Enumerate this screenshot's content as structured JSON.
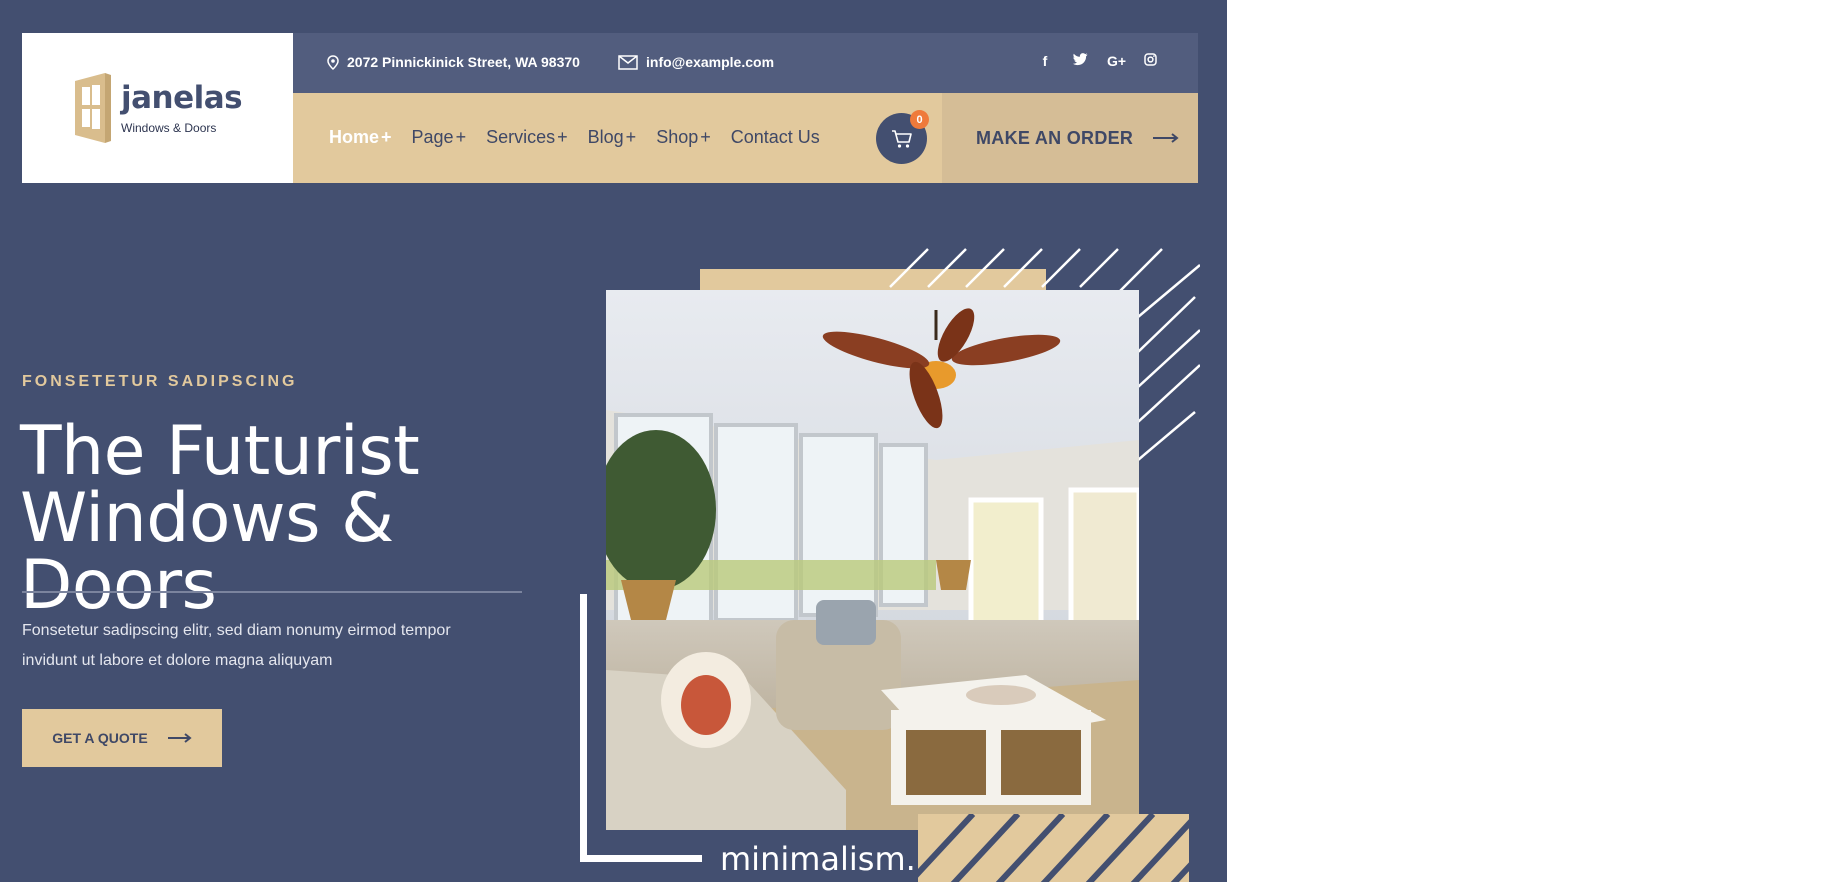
{
  "brand": {
    "name": "janelas",
    "tagline": "Windows & Doors"
  },
  "topbar": {
    "address": "2072 Pinnickinick Street, WA 98370",
    "email": "info@example.com",
    "social": [
      {
        "icon": "facebook-icon",
        "glyph": "f"
      },
      {
        "icon": "twitter-icon",
        "glyph": "t"
      },
      {
        "icon": "google-plus-icon",
        "glyph": "G+"
      },
      {
        "icon": "instagram-icon",
        "glyph": "ig"
      }
    ]
  },
  "nav": {
    "items": [
      {
        "label": "Home",
        "suffix": "+",
        "active": true
      },
      {
        "label": "Page",
        "suffix": "+"
      },
      {
        "label": "Services",
        "suffix": "+"
      },
      {
        "label": "Blog",
        "suffix": "+"
      },
      {
        "label": "Shop",
        "suffix": "+"
      },
      {
        "label": "Contact Us",
        "suffix": ""
      }
    ],
    "cart_count": "0",
    "order_label": "MAKE AN ORDER"
  },
  "hero": {
    "eyebrow": "FONSETETUR SADIPSCING",
    "title_line1": "The Futurist",
    "title_line2": "Windows & Doors",
    "description": "Fonsetetur sadipscing elitr, sed diam nonumy eirmod tempor invidunt ut labore et dolore magna aliquyam",
    "cta_label": "GET A QUOTE",
    "caption": "minimalism."
  },
  "colors": {
    "navy": "#434f70",
    "beige": "#e2c99d",
    "badge": "#ef7a3b"
  }
}
